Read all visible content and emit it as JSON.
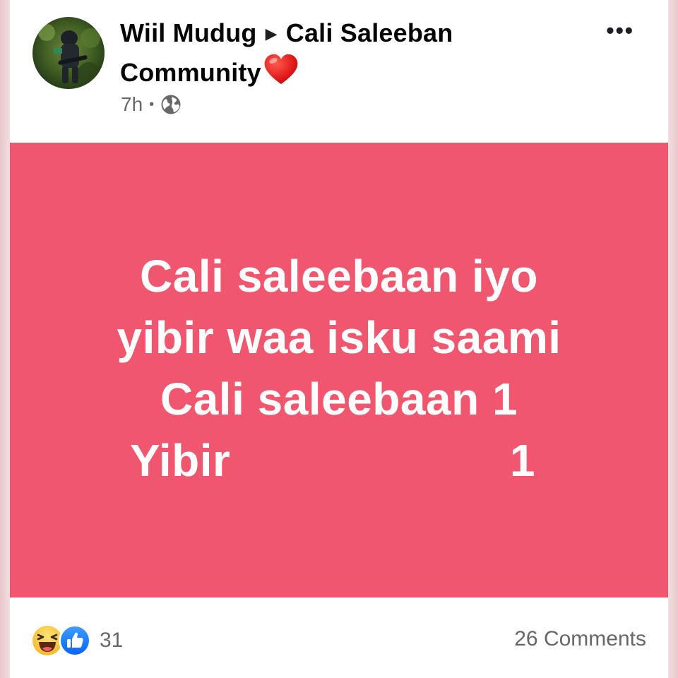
{
  "post": {
    "author": "Wiil Mudug",
    "group_separator_icon": "play-arrow-icon",
    "group_name_line1": "Cali Saleeban",
    "group_name_line2": "Community",
    "group_name_emoji": "red-heart-emoji",
    "timestamp": "7h",
    "meta_separator": "•",
    "privacy_icon": "globe-icon",
    "more_options_label": "•••",
    "background_color": "#f0566d",
    "text_color": "#ffffff",
    "text_lines": [
      "Cali saleebaan iyo",
      "yibir waa isku saami",
      "Cali saleebaan 1"
    ],
    "last_line_label": "Yibir",
    "last_line_value": "1"
  },
  "engagement": {
    "reaction_icons": [
      "haha-emoji-icon",
      "like-thumb-icon"
    ],
    "reaction_count": "31",
    "comments_label": "26 Comments"
  }
}
